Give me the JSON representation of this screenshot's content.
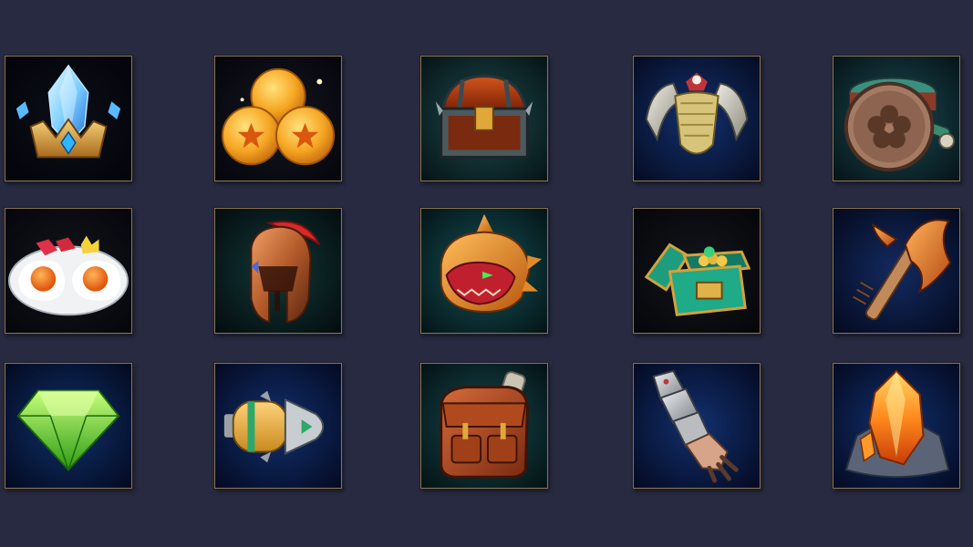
{
  "inventory": {
    "items": [
      {
        "icon": "crystal-crown-icon",
        "background": "dark"
      },
      {
        "icon": "gold-coins-icon",
        "background": "dark"
      },
      {
        "icon": "treasure-chest-icon",
        "background": "teal"
      },
      {
        "icon": "winged-pauldron-icon",
        "background": "blue"
      },
      {
        "icon": "war-drum-icon",
        "background": "teal"
      },
      {
        "icon": "fried-eggs-plate-icon",
        "background": "dark"
      },
      {
        "icon": "spartan-helmet-icon",
        "background": "teal"
      },
      {
        "icon": "dragon-helmet-icon",
        "background": "teal"
      },
      {
        "icon": "jade-treasure-box-icon",
        "background": "dark"
      },
      {
        "icon": "battle-axe-icon",
        "background": "blue"
      },
      {
        "icon": "green-gem-icon",
        "background": "blue"
      },
      {
        "icon": "rocket-capsule-icon",
        "background": "blue"
      },
      {
        "icon": "leather-backpack-icon",
        "background": "teal"
      },
      {
        "icon": "armored-gauntlet-icon",
        "background": "blue"
      },
      {
        "icon": "fire-crystal-rock-icon",
        "background": "blue"
      }
    ],
    "sky_bg": "#272a40",
    "frame_color": "#8c7650"
  }
}
